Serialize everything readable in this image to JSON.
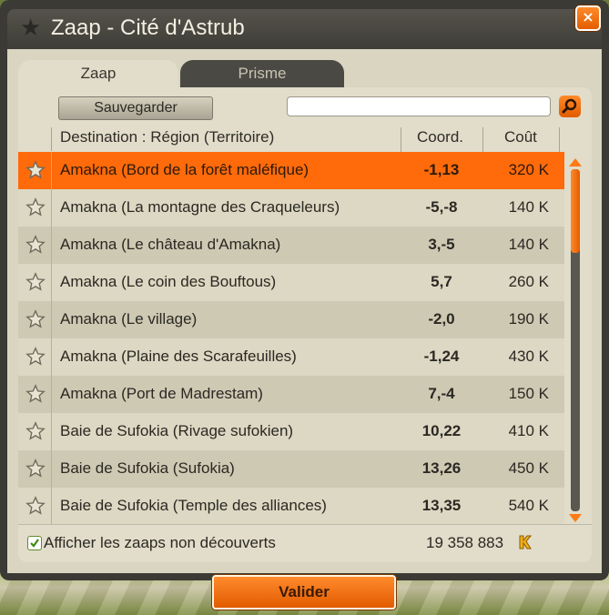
{
  "window": {
    "title": "Zaap - Cité d'Astrub",
    "close_label": "×"
  },
  "tabs": [
    {
      "label": "Zaap",
      "active": true
    },
    {
      "label": "Prisme",
      "active": false
    }
  ],
  "toolbar": {
    "save_label": "Sauvegarder",
    "search_value": "",
    "search_placeholder": ""
  },
  "table": {
    "headers": {
      "destination": "Destination : Région (Territoire)",
      "coord": "Coord.",
      "cost": "Coût"
    },
    "rows": [
      {
        "destination": "Amakna (Bord de la forêt maléfique)",
        "coord": "-1,13",
        "cost": "320 K",
        "selected": true
      },
      {
        "destination": "Amakna (La montagne des Craqueleurs)",
        "coord": "-5,-8",
        "cost": "140 K"
      },
      {
        "destination": "Amakna (Le château d'Amakna)",
        "coord": "3,-5",
        "cost": "140 K"
      },
      {
        "destination": "Amakna (Le coin des Bouftous)",
        "coord": "5,7",
        "cost": "260 K"
      },
      {
        "destination": "Amakna (Le village)",
        "coord": "-2,0",
        "cost": "190 K"
      },
      {
        "destination": "Amakna (Plaine des Scarafeuilles)",
        "coord": "-1,24",
        "cost": "430 K"
      },
      {
        "destination": "Amakna (Port de Madrestam)",
        "coord": "7,-4",
        "cost": "150 K"
      },
      {
        "destination": "Baie de Sufokia (Rivage sufokien)",
        "coord": "10,22",
        "cost": "410 K"
      },
      {
        "destination": "Baie de Sufokia (Sufokia)",
        "coord": "13,26",
        "cost": "450 K"
      },
      {
        "destination": "Baie de Sufokia (Temple des alliances)",
        "coord": "13,35",
        "cost": "540 K"
      }
    ]
  },
  "footer": {
    "show_undiscovered_label": "Afficher les zaaps non découverts",
    "show_undiscovered_checked": true,
    "kamas": "19 358 883"
  },
  "validate_label": "Valider",
  "colors": {
    "accent": "#ff6a0a",
    "panel": "#e1ddca",
    "titlebar": "#3e3d37"
  },
  "icons": {
    "title": "star-icon",
    "search": "magnifier-icon",
    "row": "star-outline-icon",
    "currency": "kama-icon",
    "checkbox": "check-icon"
  }
}
